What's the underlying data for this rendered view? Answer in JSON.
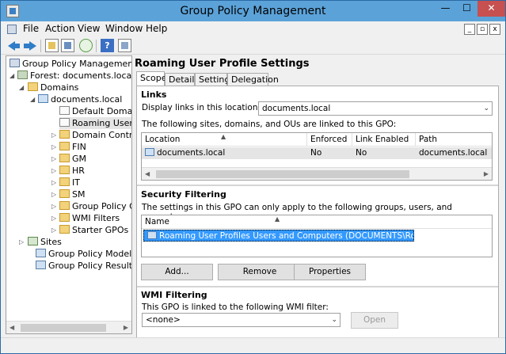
{
  "window": {
    "title": "Group Policy Management",
    "minimize": "—",
    "maximize": "☐",
    "close": "✕"
  },
  "menu": {
    "file": "File",
    "action": "Action",
    "view": "View",
    "window": "Window",
    "help": "Help"
  },
  "tree": {
    "root": "Group Policy Management",
    "forest": "Forest: documents.local",
    "domains": "Domains",
    "domain": "documents.local",
    "default_policy": "Default Domain",
    "roaming": "Roaming User P",
    "dc": "Domain Contro",
    "fin": "FIN",
    "gm": "GM",
    "hr": "HR",
    "it": "IT",
    "sm": "SM",
    "gpo": "Group Policy Ol",
    "wmi": "WMI Filters",
    "starter": "Starter GPOs",
    "sites": "Sites",
    "modeling": "Group Policy Modeling",
    "results": "Group Policy Results"
  },
  "right": {
    "title": "Roaming User Profile Settings",
    "tabs": [
      "Scope",
      "Details",
      "Settings",
      "Delegation"
    ],
    "links": {
      "heading": "Links",
      "display_label": "Display links in this location:",
      "location_value": "documents.local",
      "desc": "The following sites, domains, and OUs are linked to this GPO:",
      "columns": [
        "Location",
        "Enforced",
        "Link Enabled",
        "Path"
      ],
      "row": [
        "documents.local",
        "No",
        "No",
        "documents.local"
      ]
    },
    "security": {
      "heading": "Security Filtering",
      "desc": "The settings in this GPO can only apply to the following groups, users, and computers:",
      "column": "Name",
      "row": "Roaming User Profiles Users and Computers (DOCUMENTS\\Roaming User Profil...",
      "add": "Add...",
      "remove": "Remove",
      "properties": "Properties"
    },
    "wmi": {
      "heading": "WMI Filtering",
      "desc": "This GPO is linked to the following WMI filter:",
      "value": "<none>",
      "open": "Open"
    }
  }
}
